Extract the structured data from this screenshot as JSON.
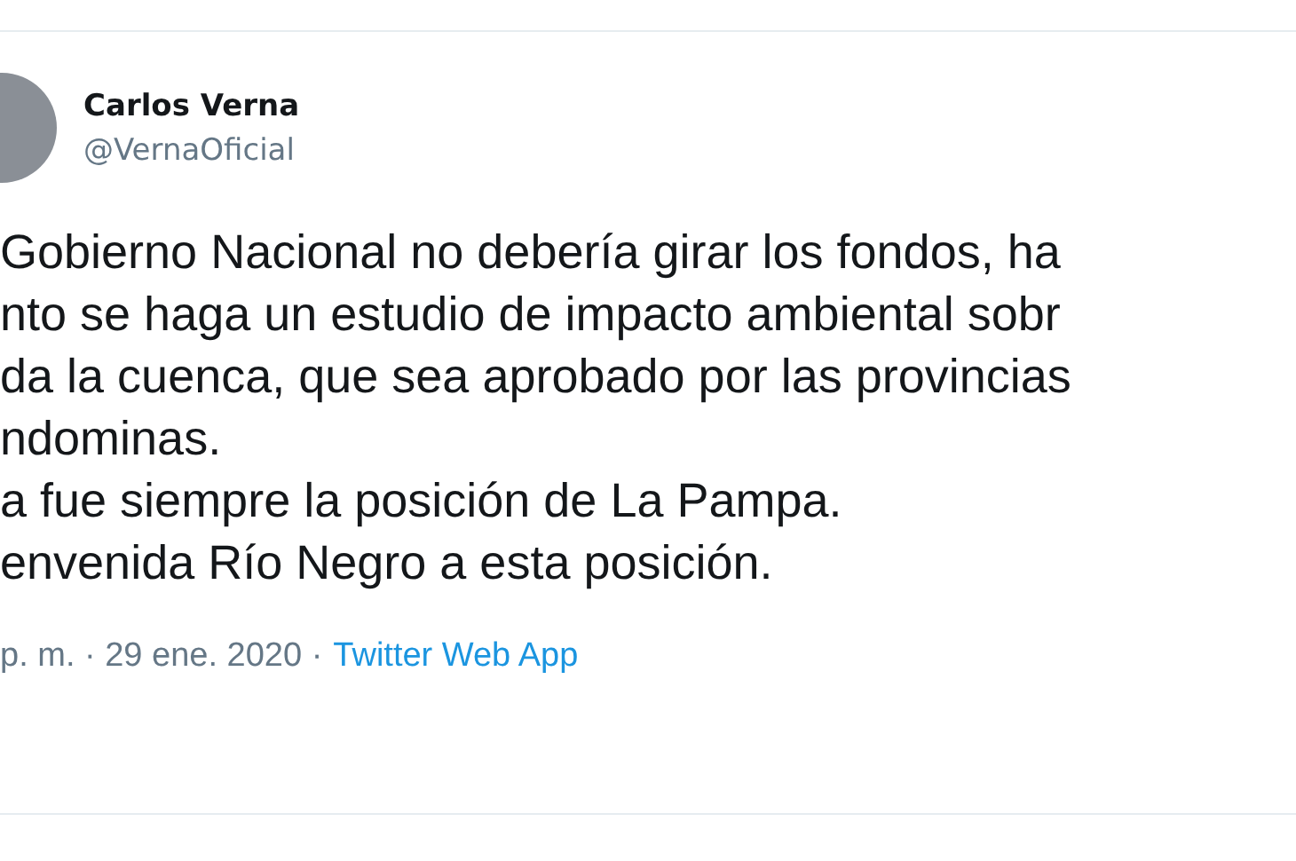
{
  "author": {
    "name": "Carlos Verna",
    "handle": "@VernaOficial"
  },
  "text_lines": [
    "Gobierno Nacional no debería girar los fondos, ha",
    "nto se haga un estudio de impacto ambiental sobr",
    "da la cuenca, que sea aprobado por las provincias",
    "ndominas.",
    "a fue siempre la posición de La Pampa.",
    "envenida Río Negro a esta posición."
  ],
  "meta": {
    "time_date": "p. m. · 29 ene. 2020 ·",
    "source": "Twitter Web App"
  }
}
